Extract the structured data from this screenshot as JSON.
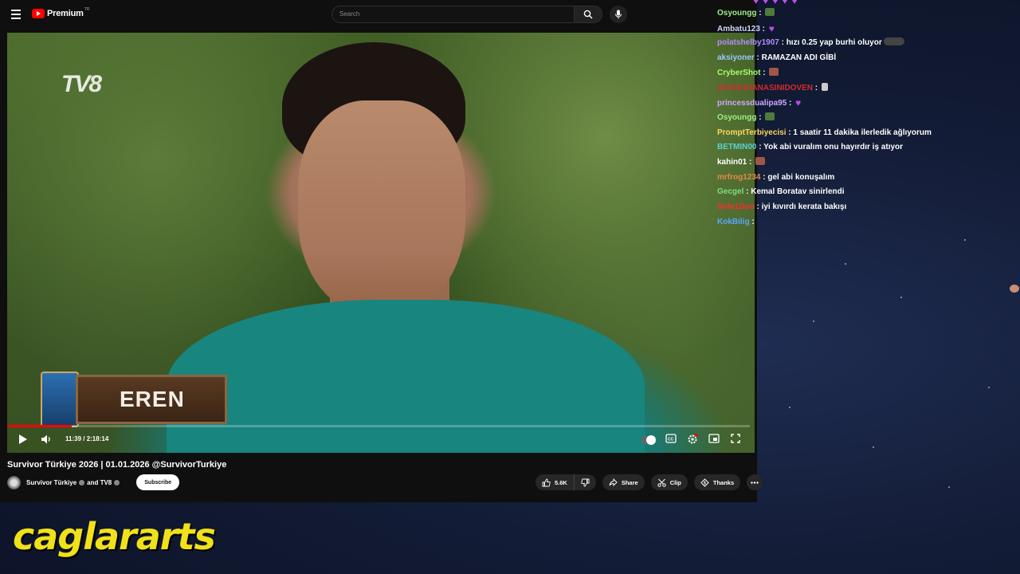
{
  "youtube": {
    "logo_text": "Premium",
    "logo_sup": "TR",
    "search_placeholder": "Search",
    "video": {
      "channel_bug": "TV8",
      "nameplate": "EREN",
      "progress_fraction": 0.0868,
      "time": "11:39 / 2:18:14"
    },
    "title": "Survivor Türkiye 2026 | 01.01.2026 @SurvivorTurkiye",
    "channel": "Survivor Türkiye",
    "channel_and": "and TV8",
    "subscribe": "Subscribe",
    "likes": "5.6K",
    "share": "Share",
    "clip": "Clip",
    "thanks": "Thanks",
    "colors": {
      "brand": "#ff0000",
      "bg": "#0f0f0f",
      "pill": "#272727"
    }
  },
  "chat": {
    "messages": [
      {
        "user": "Osyoungg",
        "color": "#9bee88",
        "text": "",
        "emote": "frog"
      },
      {
        "user": "Ambatu123",
        "color": "#c9d6ff",
        "text": "",
        "emote": "heart"
      },
      {
        "user": "polatshelby1907",
        "color": "#b58cff",
        "text": "hızı 0.25 yap burhi oluyor",
        "emote": "car"
      },
      {
        "user": "aksiyoner",
        "color": "#9cc7ff",
        "text": "RAMAZAN ADI GİBİ",
        "emote": ""
      },
      {
        "user": "CryberShot",
        "color": "#a4ff6a",
        "text": "",
        "emote": "meme"
      },
      {
        "user": "APONUNANASINIDOVEN",
        "color": "#d42b2b",
        "text": "",
        "emote": "card"
      },
      {
        "user": "princessdualipa95",
        "color": "#cfa6ff",
        "text": "",
        "emote": "heart"
      },
      {
        "user": "Osyoungg",
        "color": "#9bee88",
        "text": "",
        "emote": "frog"
      },
      {
        "user": "PromptTerbiyecisi",
        "color": "#ffd460",
        "text": "1 saatir 11 dakika ilerledik ağlıyorum",
        "emote": ""
      },
      {
        "user": "BETMIN00",
        "color": "#5ad0d0",
        "text": "Yok abi vuralım onu hayırdır iş atıyor",
        "emote": ""
      },
      {
        "user": "kahin01",
        "color": "#ffffff",
        "text": "",
        "emote": "meme"
      },
      {
        "user": "mrfrog1234",
        "color": "#e0894a",
        "text": "gel abi konuşalım",
        "emote": ""
      },
      {
        "user": "Gecgel",
        "color": "#7be07b",
        "text": "Kemal Boratav sinirlendi",
        "emote": ""
      },
      {
        "user": "Solo1Duo",
        "color": "#ff2b2b",
        "text": "iyi kıvırdı kerata bakışı",
        "emote": ""
      },
      {
        "user": "KokBilig",
        "color": "#5aa5ff",
        "text": "",
        "emote": "face"
      }
    ]
  },
  "watermark": "caglararts"
}
